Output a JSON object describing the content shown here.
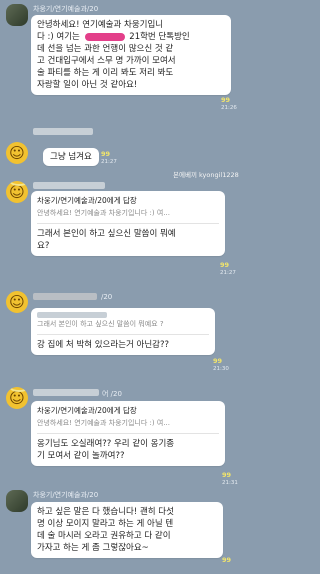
{
  "messages": [
    {
      "sender": "차웅기/연기예술과/20",
      "lines": [
        "안녕하세요! 연기예술과 차웅기입니",
        "다 :) 여기는",
        "21학번 단톡방인",
        "데 선을 넘는 과한 언행이 많으신 것 같",
        "고 건대입구에서 스무 명 가까이 모여서",
        "술 파티를 하는 게 이리 봐도 저리 봐도",
        "자랑할 일이 아닌 것 같아요!"
      ],
      "unread": "99",
      "time": "21:26"
    },
    {
      "lines": [
        "그냥 넘겨요"
      ],
      "unread": "99",
      "time": "21:27"
    },
    {
      "reply_head": "차웅기/연기예술과/20에게 답장",
      "reply_quote": "안녕하세요! 연기예술과 차웅기입니다 :) 여...",
      "lines": [
        "그래서 본인이 하고 싶으신 말씀이 뭐예",
        "요?"
      ],
      "unread": "99",
      "time": "21:27"
    },
    {
      "sender_suffix": "/20",
      "reply_quote": "그래서 본인이 하고 싶으신 말씀이 뭐예요 ?",
      "lines": [
        "강 집에 처 박혀 있으라는거 아닌감??"
      ],
      "unread": "99",
      "time": "21:30"
    },
    {
      "sender_suffix": "어 /20",
      "reply_head": "차웅기/연기예술과/20에게 답장",
      "reply_quote": "안녕하세요! 연기예술과 차웅기입니다 :) 여...",
      "lines": [
        "옹기님도 오실래여?? 우리 같이 옹기종",
        "기 모여서 같이 놀까여??"
      ],
      "unread": "99",
      "time": "21:31"
    },
    {
      "sender": "차웅기/연기예술과/20",
      "lines": [
        "하고 싶은 말은 다 했습니다! 괜히 다섯",
        "명 이상 모이지 말라고 하는 게 아닐 텐",
        "데 술 마시러 오라고 권유하고 다 같이",
        "가자고 하는 게 좀 그렇잖아요~"
      ],
      "unread": "99"
    }
  ],
  "watermark": "본에베끼 kyongil1228",
  "colors": {
    "background": "#8a9cae",
    "bubble": "#ffffff",
    "unread": "#f3e66a"
  }
}
